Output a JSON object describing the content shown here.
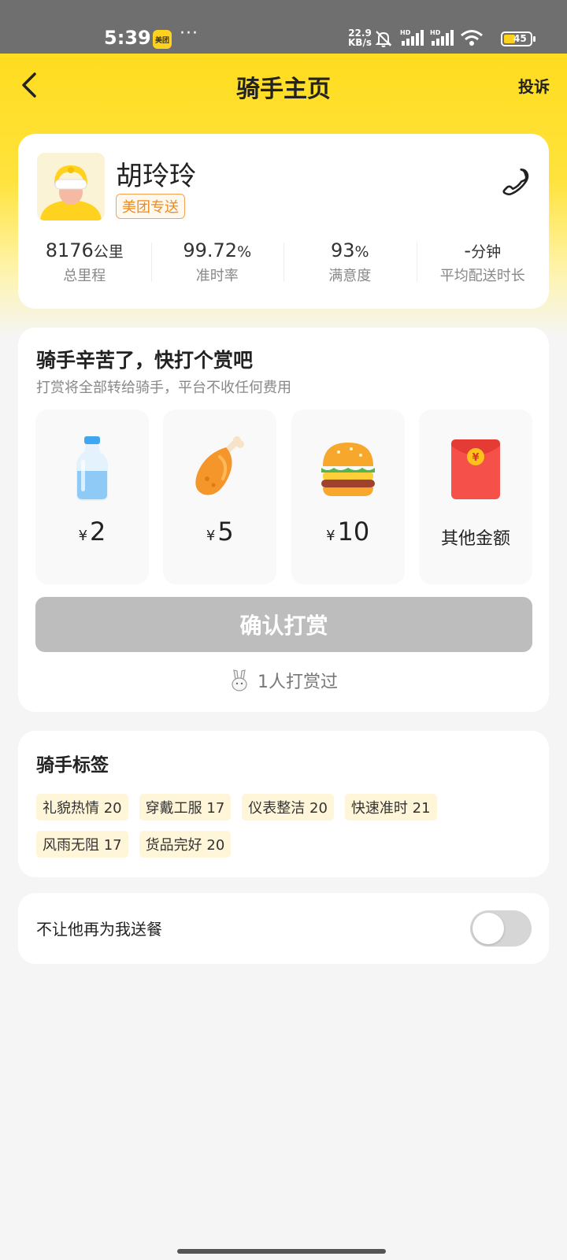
{
  "status_bar": {
    "time": "5:39",
    "app_badge": "美团",
    "more": "···",
    "net_speed_value": "22.9",
    "net_speed_unit": "KB/s",
    "battery": "45"
  },
  "header": {
    "title": "骑手主页",
    "complain_label": "投诉"
  },
  "rider": {
    "name": "胡玲玲",
    "brand": "美团专送",
    "stats": [
      {
        "value": "8176",
        "unit": "公里",
        "label": "总里程"
      },
      {
        "value": "99.72",
        "unit": "%",
        "label": "准时率"
      },
      {
        "value": "93",
        "unit": "%",
        "label": "满意度"
      },
      {
        "value": "-",
        "unit": "分钟",
        "label": "平均配送时长"
      }
    ]
  },
  "tip": {
    "title": "骑手辛苦了，快打个赏吧",
    "subtitle": "打赏将全部转给骑手，平台不收任何费用",
    "currency": "¥",
    "options": [
      {
        "icon": "water-bottle-icon",
        "amount": "2"
      },
      {
        "icon": "chicken-leg-icon",
        "amount": "5"
      },
      {
        "icon": "burger-icon",
        "amount": "10"
      },
      {
        "icon": "red-envelope-icon",
        "label": "其他金额"
      }
    ],
    "confirm_label": "确认打赏",
    "tipped_count": "1人打赏过"
  },
  "tags": {
    "title": "骑手标签",
    "items": [
      "礼貌热情 20",
      "穿戴工服 17",
      "仪表整洁 20",
      "快速准时 21",
      "风雨无阻 17",
      "货品完好 20"
    ]
  },
  "block": {
    "label": "不让他再为我送餐",
    "enabled": false
  },
  "colors": {
    "brand_yellow": "#ffdc1f",
    "badge_orange": "#f08a1a",
    "disabled_button": "#bdbdbd",
    "tag_bg": "#fff6d9"
  }
}
